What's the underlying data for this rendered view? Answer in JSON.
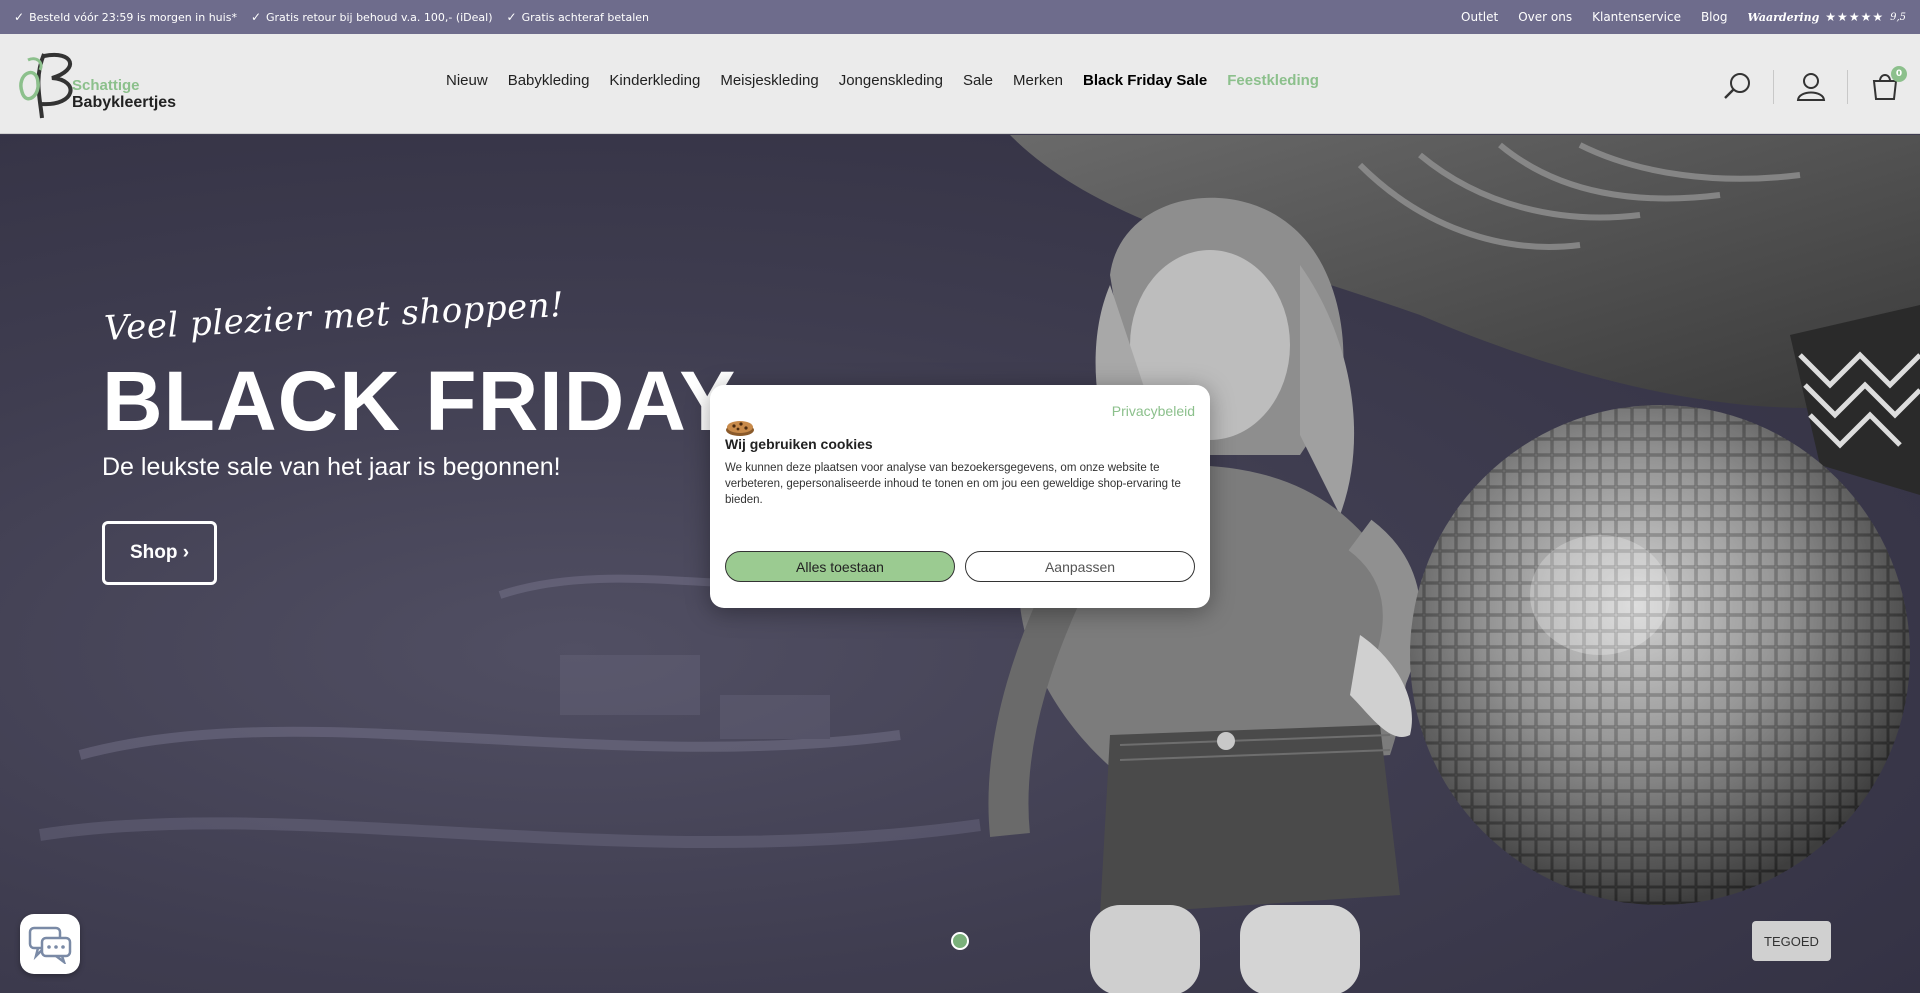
{
  "topbar": {
    "usps": [
      "Besteld vóór 23:59 is morgen in huis*",
      "Gratis retour bij behoud v.a. 100,- (iDeal)",
      "Gratis achteraf betalen"
    ],
    "links": [
      "Outlet",
      "Over ons",
      "Klantenservice",
      "Blog"
    ],
    "rating_label": "Waardering",
    "rating_stars": "★★★★★",
    "rating_score": "9,5"
  },
  "logo": {
    "line1": "Schattige",
    "line2": "Babykleertjes"
  },
  "nav": {
    "items": [
      "Nieuw",
      "Babykleding",
      "Kinderkleding",
      "Meisjeskleding",
      "Jongenskleding",
      "Sale",
      "Merken"
    ],
    "black_friday": "Black Friday Sale",
    "feest": "Feestkleding"
  },
  "header_icons": [
    "search-icon",
    "account-icon",
    "cart-icon"
  ],
  "cart_count": "0",
  "hero": {
    "tagline": "Veel plezier met shoppen!",
    "title": "BLACK FRIDAY",
    "subtitle": "De leukste sale van het jaar is begonnen!",
    "shop_label": "Shop ›"
  },
  "cookie": {
    "privacy_link": "Privacybeleid",
    "title": "Wij gebruiken cookies",
    "text": "We kunnen deze plaatsen voor analyse van bezoekersgegevens, om onze website te verbeteren, gepersonaliseerde inhoud te tonen en om jou een geweldige shop-ervaring te bieden.",
    "accept": "Alles toestaan",
    "customize": "Aanpassen"
  },
  "tegoed": "TEGOED",
  "colors": {
    "accent_green": "#8cc08c",
    "topbar": "#6e6c8c"
  }
}
